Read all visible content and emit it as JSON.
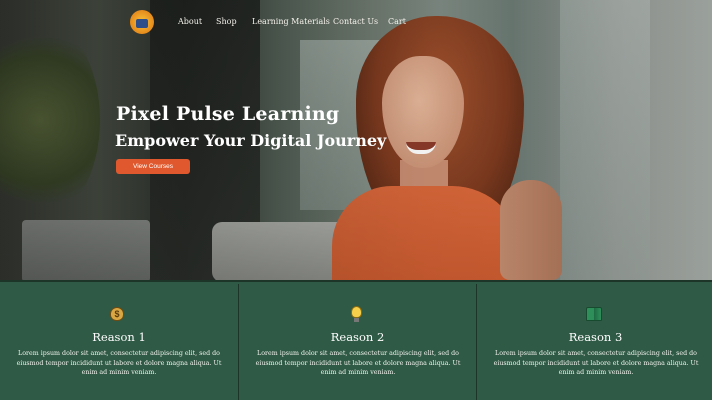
{
  "nav": {
    "logo_icon": "lightbulb-logo-icon",
    "links": [
      "About",
      "Shop",
      "Learning Materials",
      "Contact Us",
      "Cart"
    ]
  },
  "hero": {
    "title": "Pixel Pulse Learning",
    "subtitle": "Empower Your Digital Journey",
    "cta_label": "View Courses"
  },
  "reasons": [
    {
      "icon": "money-bag-icon",
      "title": "Reason 1",
      "text": "Lorem ipsum dolor sit amet, consectetur adipiscing elit, sed do eiusmod tempor incididunt ut labore et dolore magna aliqua. Ut enim ad minim veniam."
    },
    {
      "icon": "lightbulb-icon",
      "title": "Reason 2",
      "text": "Lorem ipsum dolor sit amet, consectetur adipiscing elit, sed do eiusmod tempor incididunt ut labore et dolore magna aliqua. Ut enim ad minim veniam."
    },
    {
      "icon": "book-icon",
      "title": "Reason 3",
      "text": "Lorem ipsum dolor sit amet, consectetur adipiscing elit, sed do eiusmod tempor incididunt ut labore et dolore magna aliqua. Ut enim ad minim veniam."
    }
  ],
  "colors": {
    "accent": "#e0592e",
    "section_bg": "#2f5a45",
    "text_light": "#ffffff"
  }
}
